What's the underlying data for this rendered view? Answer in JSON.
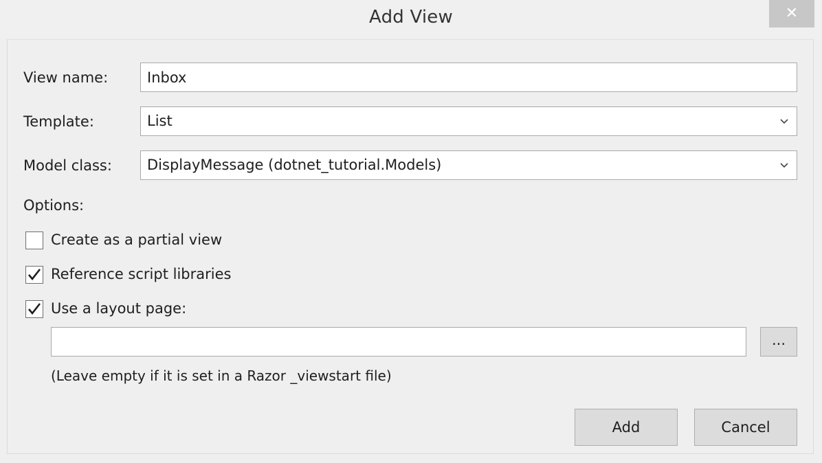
{
  "window": {
    "title": "Add View",
    "close_glyph": "✕"
  },
  "form": {
    "view_name": {
      "label": "View name:",
      "value": "Inbox"
    },
    "template": {
      "label": "Template:",
      "selected": "List"
    },
    "model_class": {
      "label": "Model class:",
      "selected": "DisplayMessage (dotnet_tutorial.Models)"
    },
    "options": {
      "label": "Options:",
      "partial_view": {
        "label": "Create as a partial view",
        "checked": false
      },
      "reference_scripts": {
        "label": "Reference script libraries",
        "checked": true
      },
      "use_layout": {
        "label": "Use a layout page:",
        "checked": true
      }
    },
    "layout_path": {
      "value": "",
      "browse_label": "...",
      "hint": "(Leave empty if it is set in a Razor _viewstart file)"
    }
  },
  "actions": {
    "add_label": "Add",
    "cancel_label": "Cancel"
  },
  "icons": {
    "close": "close-icon",
    "dropdown": "chevron-down-icon",
    "check": "checkmark-icon"
  }
}
